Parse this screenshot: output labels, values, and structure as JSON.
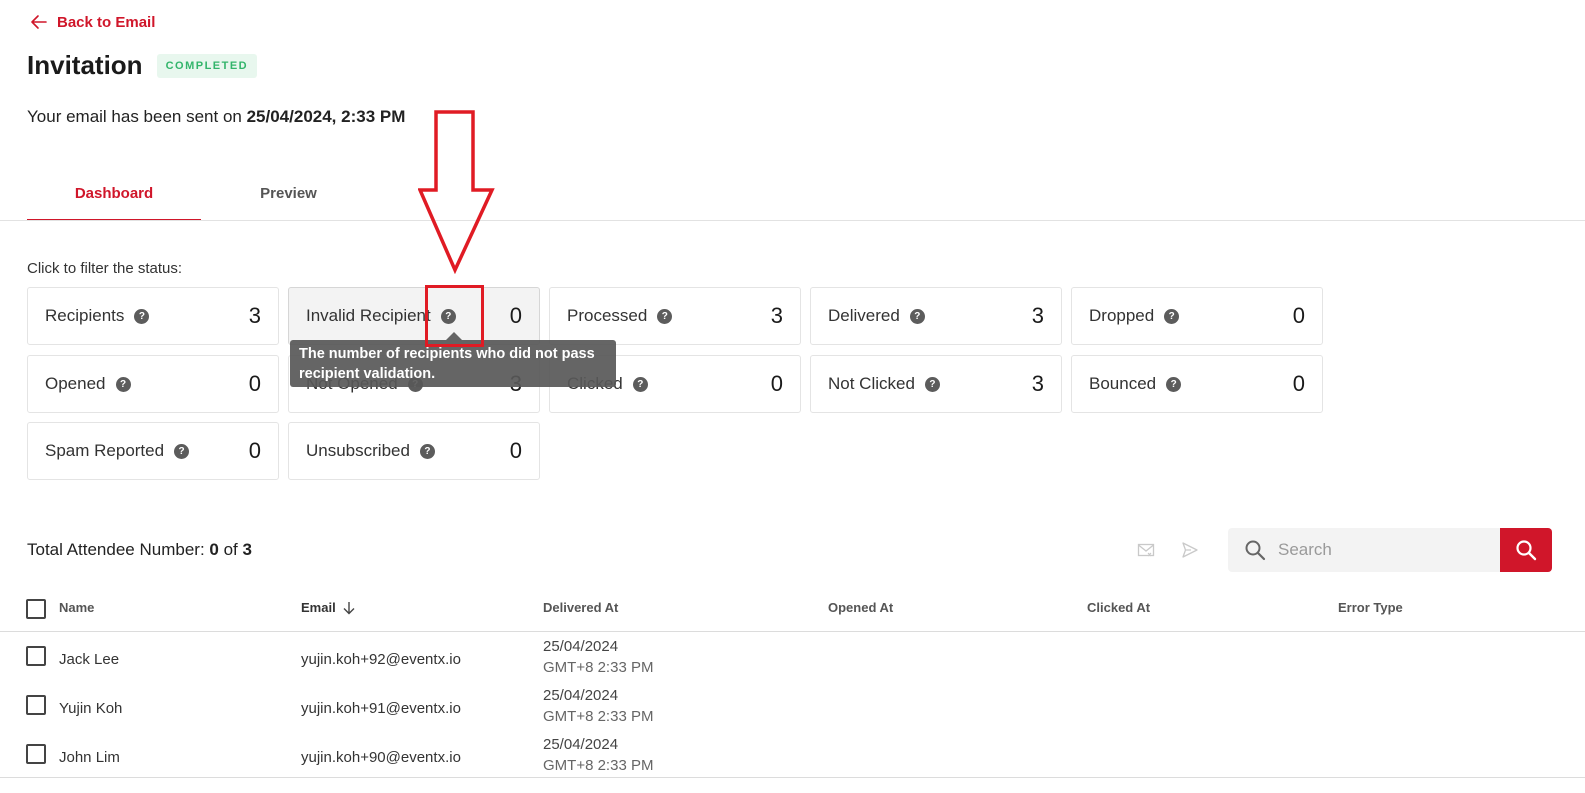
{
  "nav": {
    "back_label": "Back to Email"
  },
  "header": {
    "title": "Invitation",
    "status": "COMPLETED"
  },
  "sent": {
    "prefix": "Your email has been sent on ",
    "datetime": "25/04/2024, 2:33 PM"
  },
  "tabs": [
    {
      "label": "Dashboard",
      "active": true
    },
    {
      "label": "Preview",
      "active": false
    }
  ],
  "filter": {
    "hint": "Click to filter the status:",
    "cards": [
      {
        "label": "Recipients",
        "count": "3"
      },
      {
        "label": "Invalid Recipient",
        "count": "0"
      },
      {
        "label": "Processed",
        "count": "3"
      },
      {
        "label": "Delivered",
        "count": "3"
      },
      {
        "label": "Dropped",
        "count": "0"
      },
      {
        "label": "Opened",
        "count": "0"
      },
      {
        "label": "Not Opened",
        "count": "3"
      },
      {
        "label": "Clicked",
        "count": "0"
      },
      {
        "label": "Not Clicked",
        "count": "3"
      },
      {
        "label": "Bounced",
        "count": "0"
      },
      {
        "label": "Spam Reported",
        "count": "0"
      },
      {
        "label": "Unsubscribed",
        "count": "0"
      }
    ],
    "tooltip": "The number of recipients who did not pass recipient validation."
  },
  "help_glyph": "?",
  "attendees": {
    "total_prefix": "Total Attendee Number: ",
    "selected": "0",
    "of_text": " of ",
    "total": "3"
  },
  "search": {
    "placeholder": "Search"
  },
  "table": {
    "headers": {
      "name": "Name",
      "email": "Email",
      "delivered": "Delivered At",
      "opened": "Opened At",
      "clicked": "Clicked At",
      "error": "Error Type"
    },
    "rows": [
      {
        "name": "Jack Lee",
        "email": "yujin.koh+92@eventx.io",
        "delivered_date": "25/04/2024",
        "delivered_time": "GMT+8 2:33 PM"
      },
      {
        "name": "Yujin Koh",
        "email": "yujin.koh+91@eventx.io",
        "delivered_date": "25/04/2024",
        "delivered_time": "GMT+8 2:33 PM"
      },
      {
        "name": "John Lim",
        "email": "yujin.koh+90@eventx.io",
        "delivered_date": "25/04/2024",
        "delivered_time": "GMT+8 2:33 PM"
      }
    ]
  },
  "colors": {
    "accent": "#d0162a",
    "badge_bg": "#e8f7ee",
    "badge_text": "#33b56b",
    "annotation": "#e01b24"
  },
  "icons": [
    "arrow-left-icon",
    "help-icon",
    "resend-mail-icon",
    "send-icon",
    "search-icon",
    "sort-down-icon",
    "checkbox"
  ]
}
